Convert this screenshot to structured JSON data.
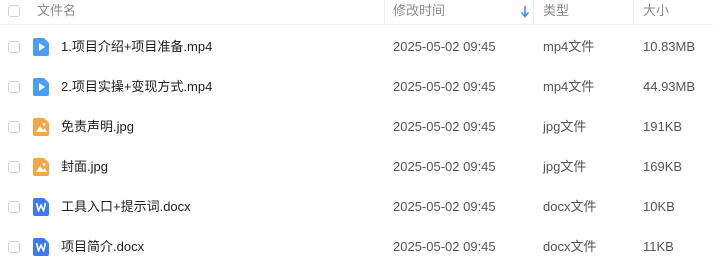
{
  "header": {
    "name": "文件名",
    "modified": "修改时间",
    "type": "类型",
    "size": "大小"
  },
  "colors": {
    "video_icon": "#4a9ff5",
    "image_icon": "#f6a54a",
    "doc_icon": "#3b7cf5",
    "sort_arrow": "#3b8cff"
  },
  "files": [
    {
      "name": "1.项目介绍+项目准备.mp4",
      "modified": "2025-05-02 09:45",
      "type": "mp4文件",
      "size": "10.83MB",
      "icon": "video-file-icon"
    },
    {
      "name": "2.项目实操+变现方式.mp4",
      "modified": "2025-05-02 09:45",
      "type": "mp4文件",
      "size": "44.93MB",
      "icon": "video-file-icon"
    },
    {
      "name": "免责声明.jpg",
      "modified": "2025-05-02 09:45",
      "type": "jpg文件",
      "size": "191KB",
      "icon": "image-file-icon"
    },
    {
      "name": "封面.jpg",
      "modified": "2025-05-02 09:45",
      "type": "jpg文件",
      "size": "169KB",
      "icon": "image-file-icon"
    },
    {
      "name": "工具入口+提示词.docx",
      "modified": "2025-05-02 09:45",
      "type": "docx文件",
      "size": "10KB",
      "icon": "word-file-icon"
    },
    {
      "name": "项目简介.docx",
      "modified": "2025-05-02 09:45",
      "type": "docx文件",
      "size": "11KB",
      "icon": "word-file-icon"
    }
  ]
}
